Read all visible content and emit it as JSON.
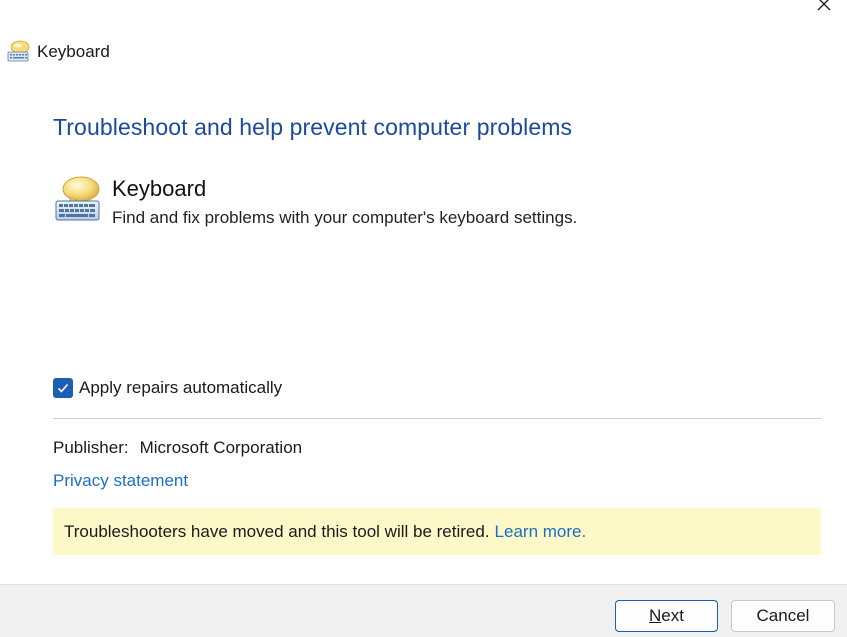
{
  "window": {
    "title": "Keyboard",
    "title_icon": "keyboard-troubleshooter-icon",
    "close_icon": "close-icon"
  },
  "heading": "Troubleshoot and help prevent computer problems",
  "troubleshooter": {
    "icon": "keyboard-troubleshooter-icon",
    "name": "Keyboard",
    "description": "Find and fix problems with your computer's keyboard settings."
  },
  "options": {
    "apply_repairs_label": "Apply repairs automatically",
    "apply_repairs_checked": true
  },
  "publisher": {
    "label": "Publisher:",
    "value": "Microsoft Corporation"
  },
  "privacy_link": "Privacy statement",
  "notice": {
    "text": "Troubleshooters have moved and this tool will be retired.",
    "link": "Learn more."
  },
  "footer": {
    "next_label": "Next",
    "cancel_label": "Cancel"
  },
  "colors": {
    "heading": "#1a4a9b",
    "link": "#1a6fc4",
    "checkbox": "#1a5fb4",
    "notice_bg": "#fdf8c8",
    "footer_bg": "#f0f0f0"
  }
}
